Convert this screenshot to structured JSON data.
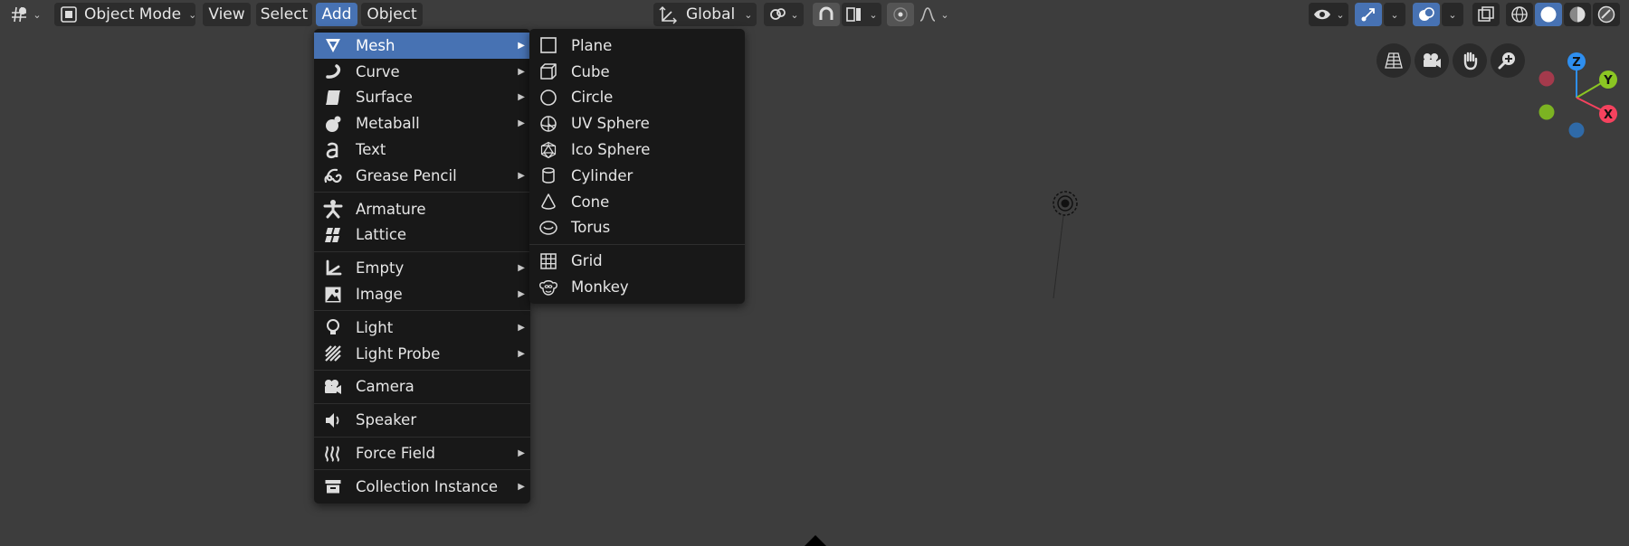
{
  "header": {
    "mode": {
      "label": "Object Mode"
    },
    "menus": [
      {
        "label": "View"
      },
      {
        "label": "Select"
      },
      {
        "label": "Add"
      },
      {
        "label": "Object"
      }
    ],
    "transform_orientation": {
      "label": "Global"
    }
  },
  "add_menu": {
    "items": [
      {
        "label": "Mesh",
        "icon": "mesh-icon",
        "submenu": true,
        "highlighted": true
      },
      {
        "label": "Curve",
        "icon": "curve-icon",
        "submenu": true
      },
      {
        "label": "Surface",
        "icon": "surface-icon",
        "submenu": true
      },
      {
        "label": "Metaball",
        "icon": "metaball-icon",
        "submenu": true
      },
      {
        "label": "Text",
        "icon": "text-icon",
        "submenu": false
      },
      {
        "label": "Grease Pencil",
        "icon": "grease-pencil-icon",
        "submenu": true
      },
      {
        "label": "Armature",
        "icon": "armature-icon",
        "submenu": false
      },
      {
        "label": "Lattice",
        "icon": "lattice-icon",
        "submenu": false
      },
      {
        "label": "Empty",
        "icon": "empty-icon",
        "submenu": true
      },
      {
        "label": "Image",
        "icon": "image-icon",
        "submenu": true
      },
      {
        "label": "Light",
        "icon": "light-icon",
        "submenu": true
      },
      {
        "label": "Light Probe",
        "icon": "light-probe-icon",
        "submenu": true
      },
      {
        "label": "Camera",
        "icon": "camera-icon",
        "submenu": false
      },
      {
        "label": "Speaker",
        "icon": "speaker-icon",
        "submenu": false
      },
      {
        "label": "Force Field",
        "icon": "force-field-icon",
        "submenu": true
      },
      {
        "label": "Collection Instance",
        "icon": "collection-instance-icon",
        "submenu": true
      }
    ]
  },
  "mesh_menu": {
    "items": [
      {
        "label": "Plane",
        "icon": "plane-icon"
      },
      {
        "label": "Cube",
        "icon": "cube-icon"
      },
      {
        "label": "Circle",
        "icon": "circle-icon"
      },
      {
        "label": "UV Sphere",
        "icon": "uv-sphere-icon"
      },
      {
        "label": "Ico Sphere",
        "icon": "ico-sphere-icon"
      },
      {
        "label": "Cylinder",
        "icon": "cylinder-icon"
      },
      {
        "label": "Cone",
        "icon": "cone-icon"
      },
      {
        "label": "Torus",
        "icon": "torus-icon"
      },
      {
        "label": "Grid",
        "icon": "grid-icon"
      },
      {
        "label": "Monkey",
        "icon": "monkey-icon"
      }
    ]
  },
  "gizmo": {
    "z": "Z",
    "y": "Y",
    "x": "X",
    "colors": {
      "x": "#f5425e",
      "y": "#8bc623",
      "z": "#2e8ff0"
    }
  },
  "colors": {
    "viewport_bg": "#3d3d3d",
    "menu_bg": "#181818",
    "highlight": "#4772b3"
  }
}
